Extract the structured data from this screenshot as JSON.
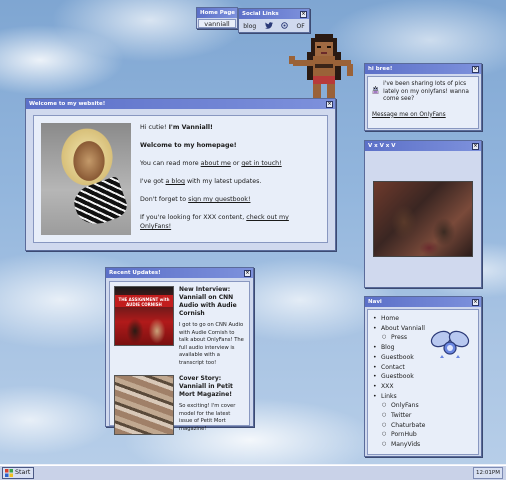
{
  "home": {
    "title": "Home Page",
    "name": "vanniall"
  },
  "social": {
    "title": "Social Links",
    "items": [
      {
        "label": "blog",
        "icon": "blog-text"
      },
      {
        "label": "",
        "icon": "twitter-icon"
      },
      {
        "label": "",
        "icon": "chaturbate-icon"
      },
      {
        "label": "OF",
        "icon": "onlyfans-text"
      }
    ]
  },
  "welcome": {
    "title": "Welcome to my website!",
    "greeting_prefix": "Hi cutie! ",
    "greeting_bold": "I'm Vanniall!",
    "heading": "Welcome to my homepage!",
    "line1_pre": "You can read more ",
    "line1_link1": "about me",
    "line1_mid": " or ",
    "line1_link2": "get in touch!",
    "line2_pre": "I've got ",
    "line2_link": "a blog",
    "line2_post": " with my latest updates.",
    "line3_pre": "Don't forget to ",
    "line3_link": "sign my guestbook!",
    "line4_pre": "If you're looking for XXX content, ",
    "line4_link": "check out my OnlyFans!"
  },
  "bree": {
    "title": "hi bree!",
    "message": "i've been sharing lots of pics lately on my onlyfans! wanna come see?",
    "link": "Message me on OnlyFans"
  },
  "vxv": {
    "title": "V x V x V"
  },
  "navi": {
    "title": "Navi",
    "items": [
      {
        "label": "Home",
        "level": 0
      },
      {
        "label": "About Vanniall",
        "level": 0
      },
      {
        "label": "Press",
        "level": 1
      },
      {
        "label": "Blog",
        "level": 0
      },
      {
        "label": "Guestbook",
        "level": 0
      },
      {
        "label": "Contact",
        "level": 0
      },
      {
        "label": "Guestbook",
        "level": 0
      },
      {
        "label": "XXX",
        "level": 0
      },
      {
        "label": "Links",
        "level": 0
      },
      {
        "label": "OnlyFans",
        "level": 1
      },
      {
        "label": "Twitter",
        "level": 1
      },
      {
        "label": "Chaturbate",
        "level": 1
      },
      {
        "label": "PornHub",
        "level": 1
      },
      {
        "label": "ManyVids",
        "level": 1
      }
    ]
  },
  "updates": {
    "title": "Recent Updates!",
    "posts": [
      {
        "title": "New Interview: Vanniall on CNN Audio with Audie Cornish",
        "body": "I got to go on CNN Audio with Audie Cornish to talk about OnlyFans! The full audio interview is available with a transcript too!",
        "thumb_caption": "THE ASSIGNMENT with AUDIE CORNISH"
      },
      {
        "title": "Cover Story: Vanniall in Petit Mort Magazine!",
        "body": "So exciting! I'm cover model for the latest issue of Petit Mort magazine!"
      }
    ]
  },
  "taskbar": {
    "start": "Start",
    "clock": "12:01PM"
  },
  "colors": {
    "titlebar": "#5c70c8",
    "window": "#d0d9ee",
    "panel": "#e8eef9"
  }
}
